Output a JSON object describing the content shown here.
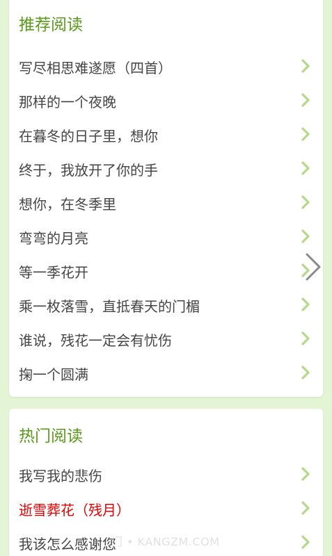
{
  "recommend": {
    "title": "推荐阅读",
    "items": [
      {
        "label": "写尽相思难遂愿（四首）"
      },
      {
        "label": "那样的一个夜晚"
      },
      {
        "label": "在暮冬的日子里，想你"
      },
      {
        "label": "终于，我放开了你的手"
      },
      {
        "label": "想你，在冬季里"
      },
      {
        "label": "弯弯的月亮"
      },
      {
        "label": "等一季花开"
      },
      {
        "label": "乘一枚落雪，直抵春天的门楣"
      },
      {
        "label": "谁说，残花一定会有忧伤"
      },
      {
        "label": "掬一个圆满"
      }
    ]
  },
  "hot": {
    "title": "热门阅读",
    "items": [
      {
        "label": "我写我的悲伤"
      },
      {
        "label": "逝雪葬花（残月）"
      },
      {
        "label": "我该怎么感谢您"
      }
    ]
  },
  "watermark": {
    "text": "门 • KANGZM.COM"
  },
  "colors": {
    "background": "#e3f5d4",
    "title_green": "#5a9a1a",
    "chevron_green": "#b5d98a",
    "text_dark": "#454545",
    "highlight_red": "#e60000"
  },
  "icons": {
    "list_arrow": "chevron-right-icon",
    "overlay_arrow": "next-arrow-icon"
  }
}
